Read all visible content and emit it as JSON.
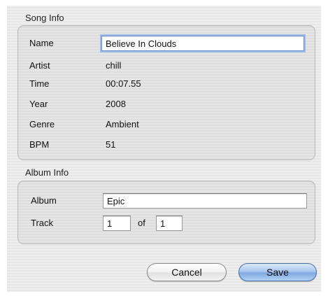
{
  "song_info": {
    "title": "Song Info",
    "name_label": "Name",
    "name_value": "Believe In Clouds",
    "artist_label": "Artist",
    "artist_value": "chill",
    "time_label": "Time",
    "time_value": "00:07.55",
    "year_label": "Year",
    "year_value": "2008",
    "genre_label": "Genre",
    "genre_value": "Ambient",
    "bpm_label": "BPM",
    "bpm_value": "51"
  },
  "album_info": {
    "title": "Album Info",
    "album_label": "Album",
    "album_value": "Epic",
    "track_label": "Track",
    "track_value": "1",
    "of_label": "of",
    "track_total_value": "1"
  },
  "buttons": {
    "cancel_label": "Cancel",
    "save_label": "Save"
  },
  "colors": {
    "focus_ring": "#9cbbe6",
    "default_button": "#7fa9e0"
  }
}
